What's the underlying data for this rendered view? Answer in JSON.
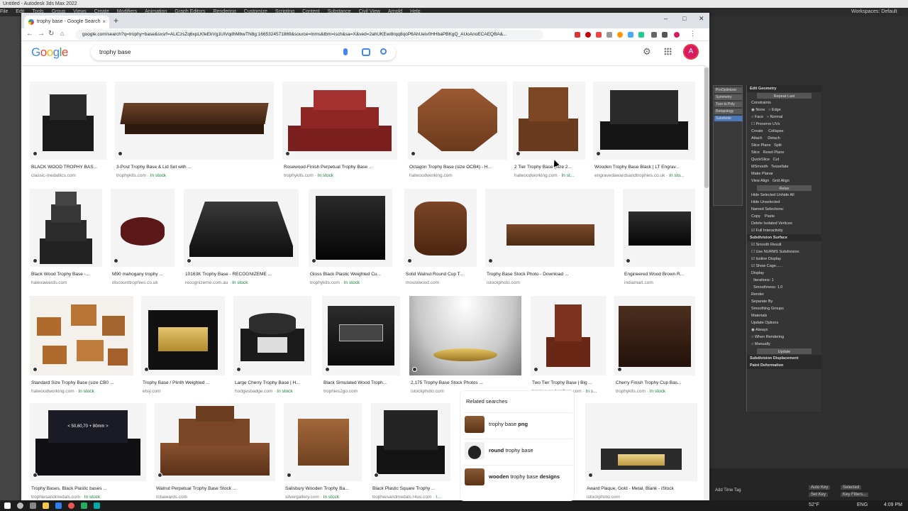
{
  "max": {
    "title": "Untitled - Autodesk 3ds Max 2022",
    "menu": [
      "File",
      "Edit",
      "Tools",
      "Group",
      "Views",
      "Create",
      "Modifiers",
      "Animation",
      "Graph Editors",
      "Rendering",
      "Customize",
      "Scripting",
      "Content",
      "Substance",
      "Civil View",
      "Arnold",
      "Help"
    ],
    "workspaces_label": "Workspaces:",
    "workspaces_value": "Default",
    "viewport_buttons": [
      "ProOptimizer",
      "Symmetry",
      "Turn to Poly",
      "Retopology",
      "Subdivide"
    ],
    "panel": {
      "edit_geometry": "Edit Geometry",
      "repeat_last": "Repeat Last",
      "constraints": "Constraints",
      "none": "None",
      "edge": "Edge",
      "face": "Face",
      "normal": "Normal",
      "preserve_uvs": "Preserve UVs",
      "create": "Create",
      "collapse": "Collapse",
      "attach": "Attach",
      "detach": "Detach",
      "slice_plane": "Slice Plane",
      "split": "Split",
      "slice": "Slice",
      "reset_plane": "Reset Plane",
      "quickslice": "QuickSlice",
      "cut": "Cut",
      "msmooth": "MSmooth",
      "tessellate": "Tessellate",
      "make_planar": "Make Planar",
      "view_align": "View Align",
      "grid_align": "Grid Align",
      "relax": "Relax",
      "hide_selected": "Hide Selected",
      "unhide_all": "Unhide All",
      "hide_unselected": "Hide Unselected",
      "named_selections": "Named Selections:",
      "copy": "Copy",
      "paste": "Paste",
      "delete_isolated": "Delete Isolated Vertices",
      "full_interactivity": "Full Interactivity",
      "subdivision_surface": "Subdivision Surface",
      "smooth_result": "Smooth Result",
      "use_nurms": "Use NURMS Subdivision",
      "isoline_display": "Isoline Display",
      "show_cage": "Show Cage......",
      "display": "Display",
      "iterations": "Iterations:",
      "smoothness": "Smoothness:",
      "render": "Render",
      "separate_by": "Separate By",
      "smoothing_groups": "Smoothing Groups",
      "materials": "Materials",
      "update_options": "Update Options",
      "always": "Always",
      "when_rendering": "When Rendering",
      "manually": "Manually",
      "update": "Update",
      "subdivision_displacement": "Subdivision Displacement",
      "paint_deformation": "Paint Deformation",
      "iterations_val": "1",
      "smoothness_val": "1.0"
    },
    "time_tag": "Add Time Tag",
    "auto_key": "Auto Key",
    "selected": "Selected",
    "set_key": "Set Key",
    "key_filters": "Key Filters..."
  },
  "taskbar": {
    "weather": "52°F",
    "lang": "ENG",
    "clock": "4:09 PM"
  },
  "chrome": {
    "tab_title": "trophy base - Google Search",
    "url": "google.com/search?q=trophy+base&sxsrf=ALiCzsZq6xpLKfeEkVg1UlVqdhMbwTN8g:1665324571869&source=lnms&tbm=isch&sa=X&ved=2ahUKEwi8rqq8qoP6AhUeiv0HHbaPBKgQ_AUoAnoECAEQBA&..."
  },
  "google": {
    "query": "trophy base",
    "avatar_letter": "A"
  },
  "results": [
    {
      "caption": "BLACK WOOD TROPHY BAS...",
      "source": "classic-medallics.com",
      "stock": ""
    },
    {
      "caption": "3-Post Trophy Base & Lid Set with ...",
      "source": "trophykits.com",
      "stock": "In stock"
    },
    {
      "caption": "Rosewood-Finish Perpetual Trophy Base ...",
      "source": "trophykits.com",
      "stock": "In stock"
    },
    {
      "caption": "Octagon Trophy Base (size OCB4) - H...",
      "source": "halwoodworking.com",
      "stock": ""
    },
    {
      "caption": "2 Tier Trophy Base (size 2...",
      "source": "halwoodworking.com",
      "stock": "In st..."
    },
    {
      "caption": "Wooden Trophy Base Black | LT Engrav...",
      "source": "engravedawardsandtrophies.co.uk",
      "stock": "In sto..."
    },
    {
      "caption": "Black Wood Trophy Base -...",
      "source": "halexawards.com",
      "stock": ""
    },
    {
      "caption": "M90 mahogany trophy ...",
      "source": "discounttrophies.co.uk",
      "stock": ""
    },
    {
      "caption": "10163K Trophy Base - RECOGNIZEME ...",
      "source": "recognizeme.com.au",
      "stock": "In stock"
    },
    {
      "caption": "Gloss Black Plastic Weighted Cu...",
      "source": "trophykits.com",
      "stock": "In stock"
    },
    {
      "caption": "Solid Walnut Round Cup T...",
      "source": "mosiowood.com",
      "stock": ""
    },
    {
      "caption": "Trophy Base Stock Photo - Download ...",
      "source": "istockphoto.com",
      "stock": ""
    },
    {
      "caption": "Engineered Wood Brown R...",
      "source": "indiamart.com",
      "stock": ""
    },
    {
      "caption": "Standard Size Trophy Base (size CB0 ...",
      "source": "halwoodworking.com",
      "stock": "In stock"
    },
    {
      "caption": "Trophy Base / Plinth Weighted ...",
      "source": "etsy.com",
      "stock": ""
    },
    {
      "caption": "Large Cherry Trophy Base | H...",
      "source": "hodgesbadge.com",
      "stock": "In stock"
    },
    {
      "caption": "Black Simulated Wood Troph...",
      "source": "trophies2go.com",
      "stock": ""
    },
    {
      "caption": "2,175 Trophy Base Stock Photos ...",
      "source": "istockphoto.com",
      "stock": ""
    },
    {
      "caption": "Two Tier Trophy Base | Big ...",
      "source": "bigskywoodcrafters.com",
      "stock": "In s..."
    },
    {
      "caption": "Cherry Finish Trophy Cup Bas...",
      "source": "trophykits.com",
      "stock": "In stock"
    },
    {
      "caption": "Trophy Bases, Black Plastic bases ...",
      "source": "trophiesandmedals.com",
      "stock": "In stock"
    },
    {
      "caption": "Walnut Perpetual Trophy Base Stock ...",
      "source": "rcbawards.com",
      "stock": ""
    },
    {
      "caption": "Salisbury Wooden Trophy Ba...",
      "source": "silvergallery.com",
      "stock": "In stock"
    },
    {
      "caption": "Black Plastic Square Trophy ...",
      "source": "trophiesandmedals.r4us.com",
      "stock": "I..."
    },
    {
      "caption": "Award Plaque, Gold - Metal, Blank - iStock",
      "source": "istockphoto.com",
      "stock": ""
    }
  ],
  "base_size_label": "< 50,60,70 + 80mm >",
  "related": {
    "title": "Related searches",
    "items": [
      {
        "bold_after": "png",
        "plain": "trophy base ",
        "order": "plain-first"
      },
      {
        "bold": "round",
        "plain": " trophy base",
        "order": "bold-first"
      },
      {
        "bold": "wooden",
        "plain": " trophy base ",
        "bold_after": "designs",
        "order": "bold-first"
      }
    ]
  },
  "colors": {
    "google_blue": "#4285f4",
    "google_red": "#ea4335",
    "google_yellow": "#fbbc05",
    "google_green": "#34a853",
    "stock_green": "#188038",
    "avatar": "#d81b60"
  }
}
